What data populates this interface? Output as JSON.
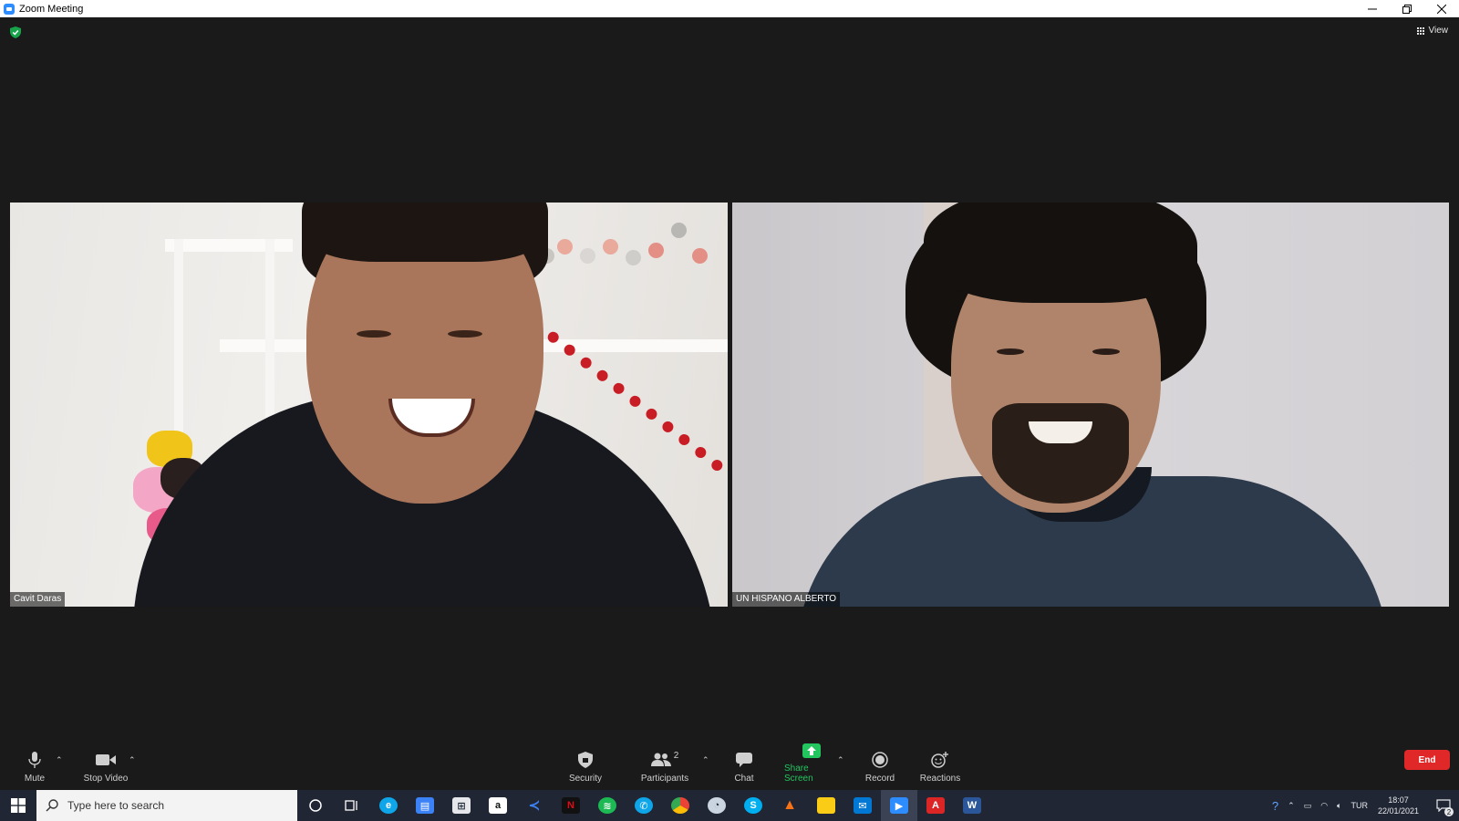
{
  "window": {
    "title": "Zoom Meeting"
  },
  "header": {
    "view_label": "View"
  },
  "participants": [
    {
      "name": "Cavit Daras"
    },
    {
      "name": "UN HISPANO ALBERTO"
    }
  ],
  "toolbar": {
    "mute_label": "Mute",
    "stop_video_label": "Stop Video",
    "security_label": "Security",
    "participants_label": "Participants",
    "participants_count": "2",
    "chat_label": "Chat",
    "share_screen_label": "Share Screen",
    "record_label": "Record",
    "reactions_label": "Reactions",
    "end_label": "End"
  },
  "taskbar": {
    "search_placeholder": "Type here to search",
    "language": "TUR",
    "time": "18:07",
    "date": "22/01/2021",
    "notification_count": "2"
  },
  "colors": {
    "zoom_blue": "#2d8cff",
    "share_green": "#22c55e",
    "end_red": "#e02828",
    "shield_green": "#16a34a"
  }
}
